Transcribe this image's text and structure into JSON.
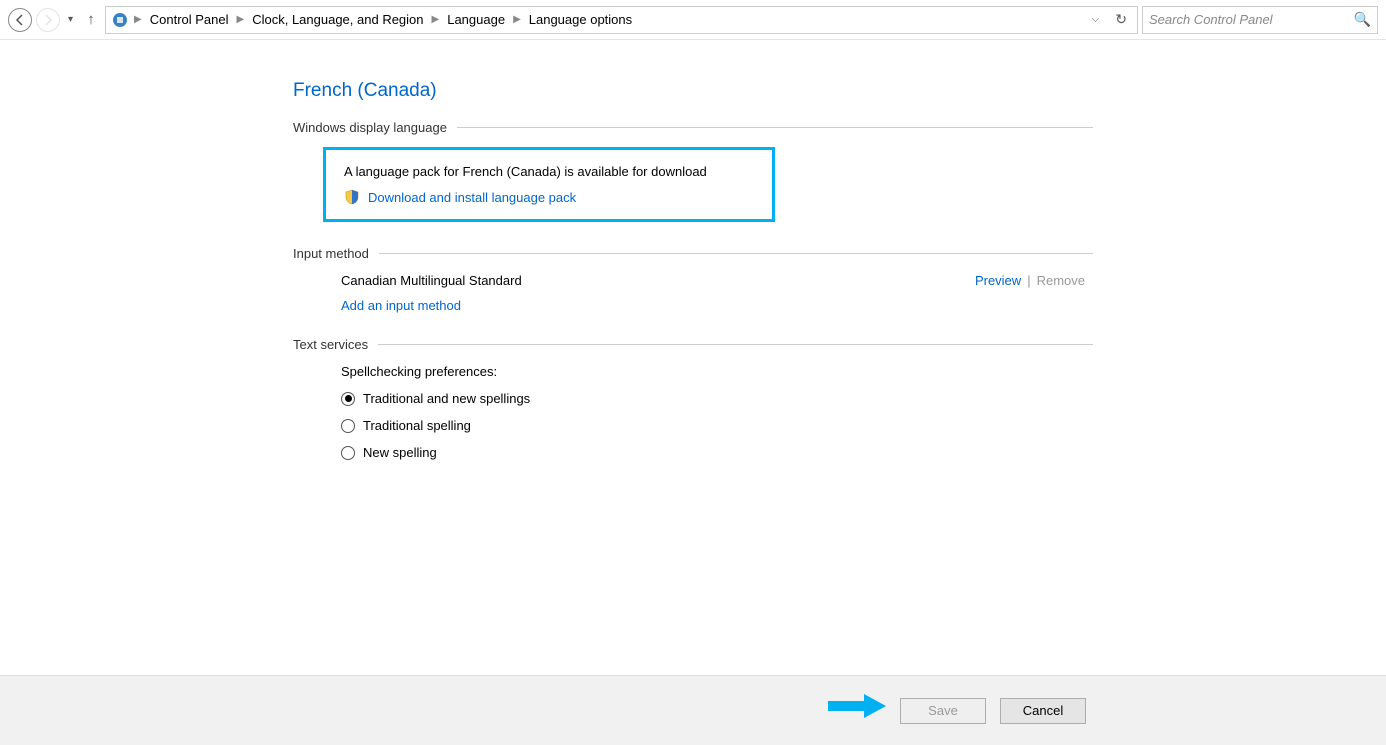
{
  "breadcrumb": {
    "items": [
      "Control Panel",
      "Clock, Language, and Region",
      "Language",
      "Language options"
    ]
  },
  "search": {
    "placeholder": "Search Control Panel"
  },
  "page": {
    "title": "French (Canada)"
  },
  "sections": {
    "display_language": {
      "label": "Windows display language",
      "message": "A language pack for French (Canada) is available for download",
      "download_link": "Download and install language pack"
    },
    "input_method": {
      "label": "Input method",
      "current": "Canadian Multilingual Standard",
      "preview": "Preview",
      "separator": "|",
      "remove": "Remove",
      "add_link": "Add an input method"
    },
    "text_services": {
      "label": "Text services",
      "spell_label": "Spellchecking preferences:",
      "options": [
        {
          "label": "Traditional and new spellings",
          "checked": true
        },
        {
          "label": "Traditional spelling",
          "checked": false
        },
        {
          "label": "New spelling",
          "checked": false
        }
      ]
    }
  },
  "footer": {
    "save": "Save",
    "cancel": "Cancel"
  }
}
